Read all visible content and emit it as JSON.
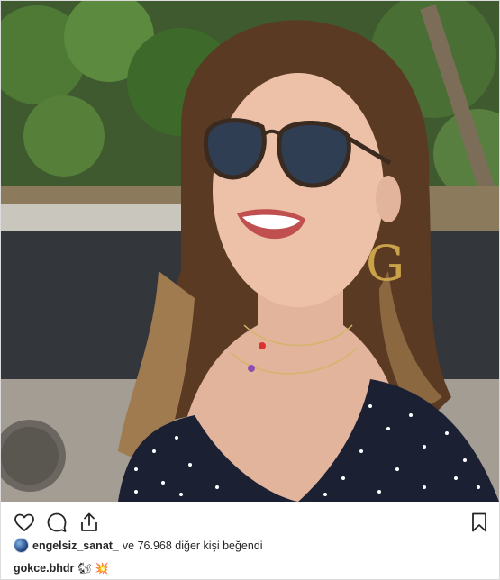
{
  "post": {
    "liked_by_user": "engelsiz_sanat_",
    "liked_by_rest": "ve 76.968 diğer kişi beğendi",
    "caption_owner": "gokce.bhdr",
    "caption_emojis": [
      "🐿",
      "💥"
    ]
  },
  "icons": {
    "like": "heart-icon",
    "comment": "comment-icon",
    "share": "share-icon",
    "save": "bookmark-icon"
  },
  "colors": {
    "text": "#262626",
    "border": "#dbdbdb"
  }
}
